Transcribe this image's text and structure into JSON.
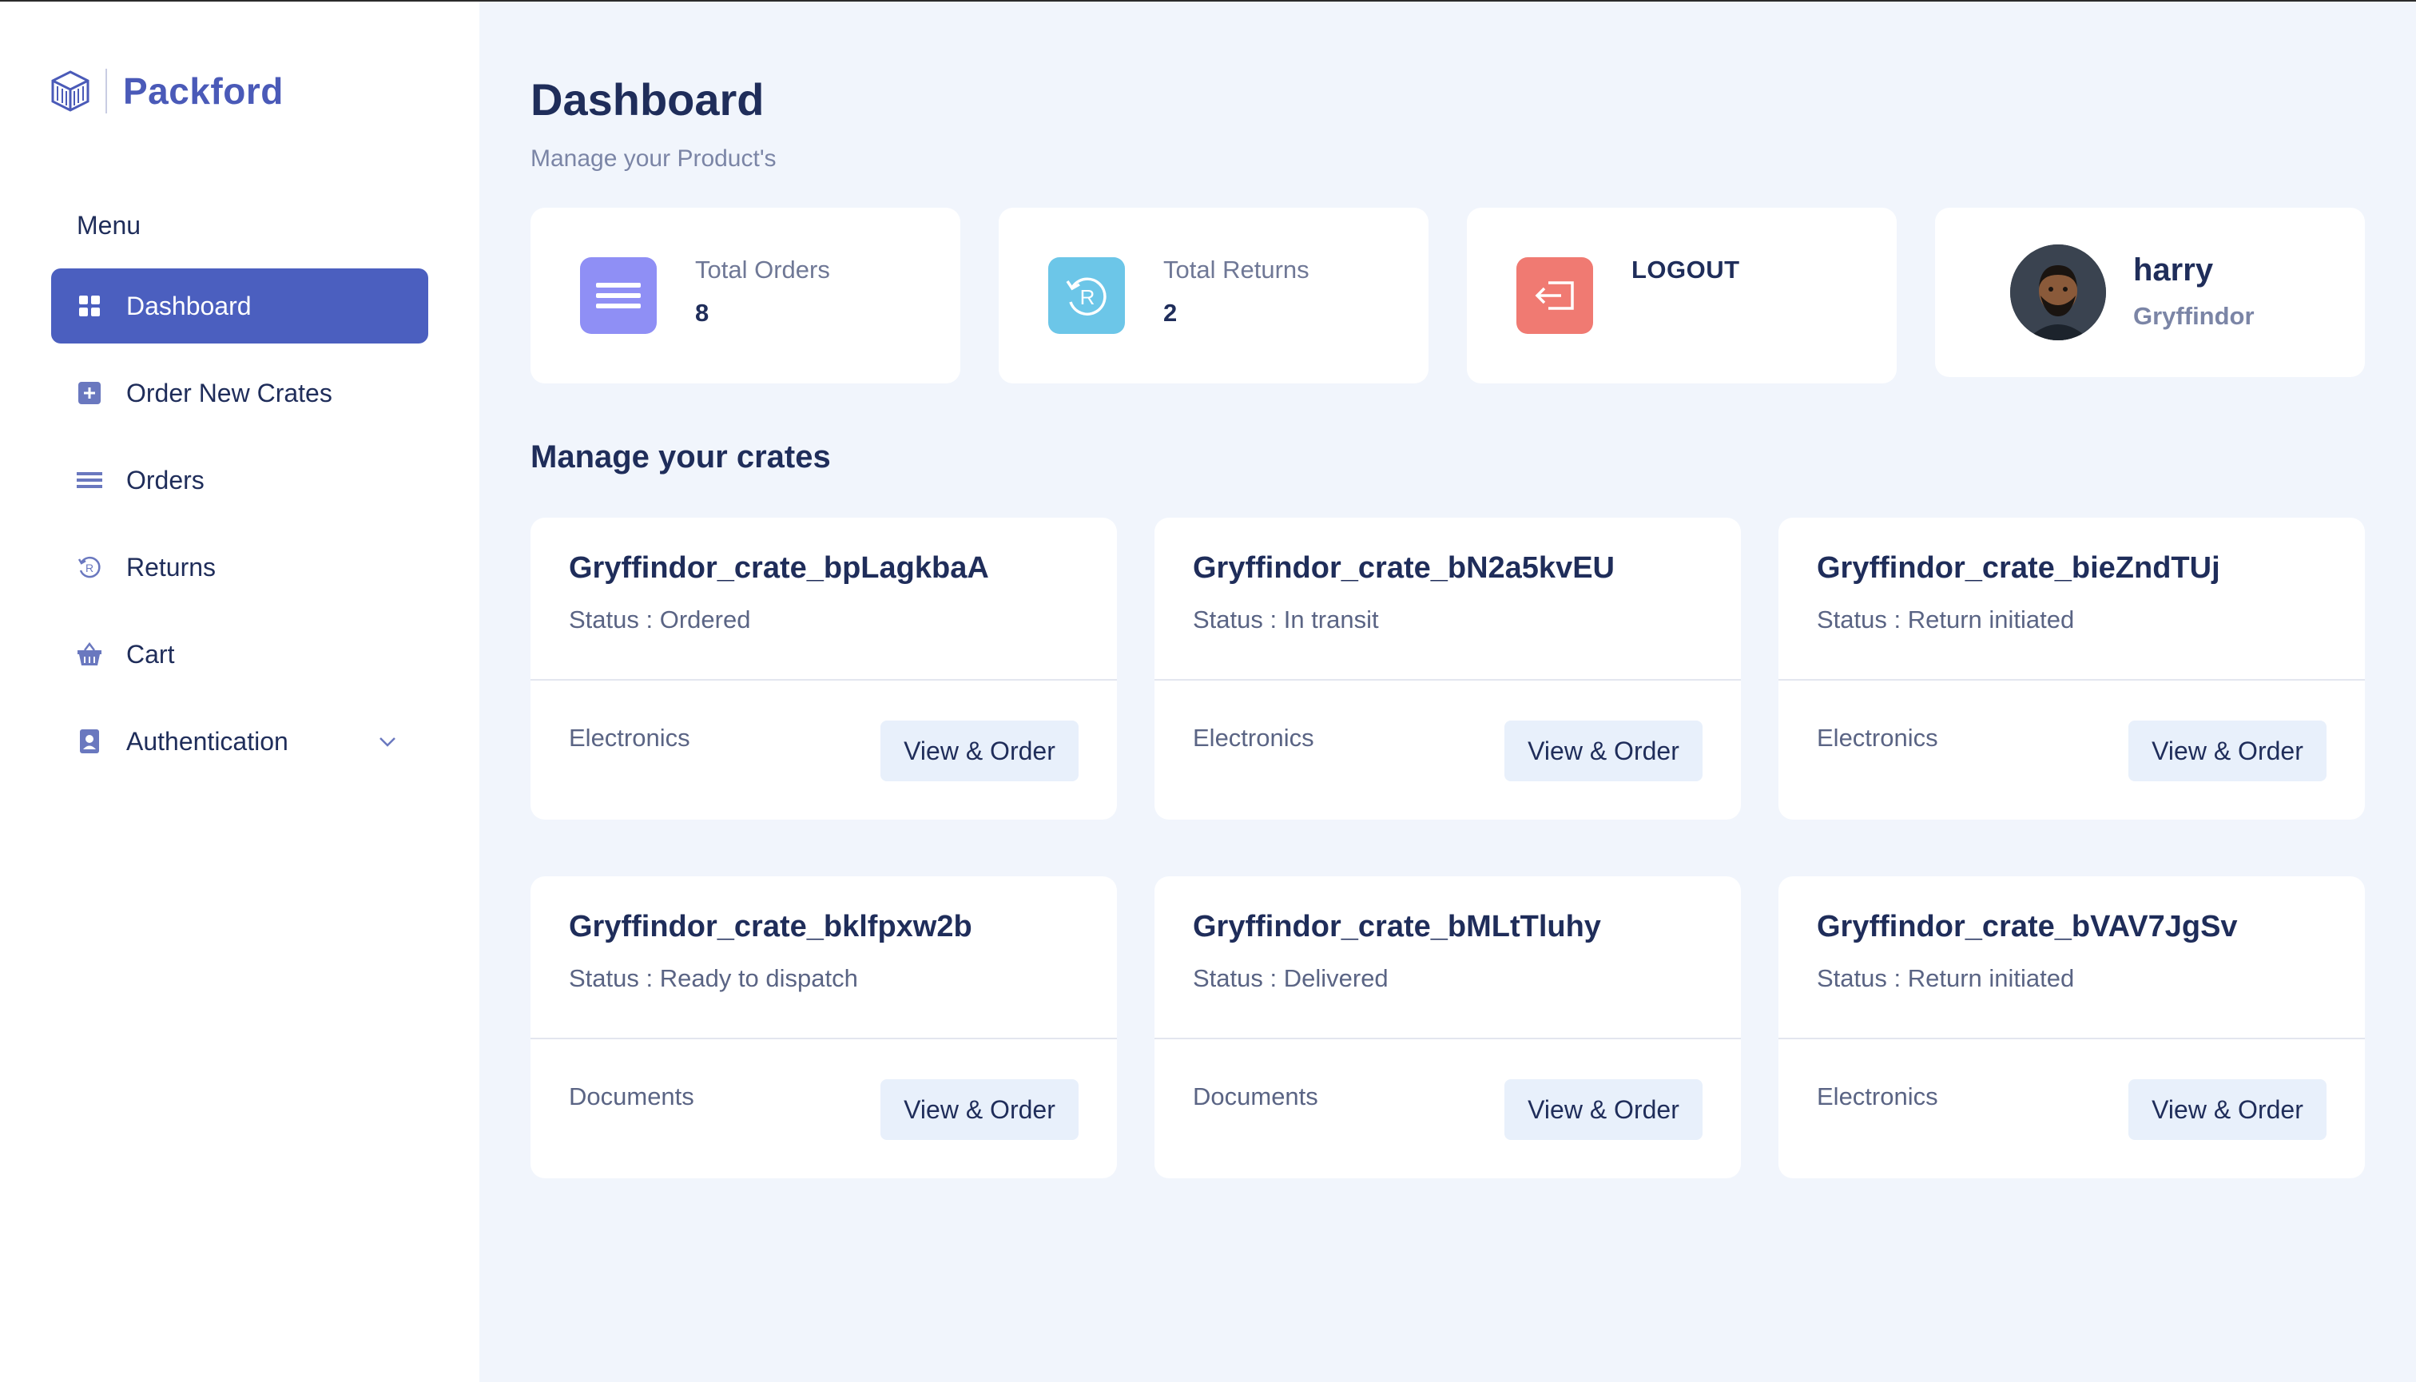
{
  "brand": {
    "name": "Packford"
  },
  "sidebar": {
    "menu_title": "Menu",
    "items": [
      {
        "label": "Dashboard",
        "icon": "grid-icon",
        "active": true
      },
      {
        "label": "Order New Crates",
        "icon": "plus-square-icon"
      },
      {
        "label": "Orders",
        "icon": "list-icon"
      },
      {
        "label": "Returns",
        "icon": "return-icon"
      },
      {
        "label": "Cart",
        "icon": "basket-icon"
      },
      {
        "label": "Authentication",
        "icon": "id-badge-icon",
        "has_dropdown": true
      }
    ]
  },
  "header": {
    "title": "Dashboard",
    "subtitle": "Manage your Product's"
  },
  "stats": {
    "total_orders": {
      "label": "Total Orders",
      "value": "8"
    },
    "total_returns": {
      "label": "Total Returns",
      "value": "2"
    },
    "logout": {
      "label": "LOGOUT"
    }
  },
  "profile": {
    "name": "harry",
    "house": "Gryffindor"
  },
  "crates_section": {
    "title": "Manage your crates"
  },
  "crates": [
    {
      "name": "Gryffindor_crate_bpLagkbaA",
      "status": "Status : Ordered",
      "category": "Electronics",
      "button": "View & Order"
    },
    {
      "name": "Gryffindor_crate_bN2a5kvEU",
      "status": "Status : In transit",
      "category": "Electronics",
      "button": "View & Order"
    },
    {
      "name": "Gryffindor_crate_bieZndTUj",
      "status": "Status : Return initiated",
      "category": "Electronics",
      "button": "View & Order"
    },
    {
      "name": "Gryffindor_crate_bklfpxw2b",
      "status": "Status : Ready to dispatch",
      "category": "Documents",
      "button": "View & Order"
    },
    {
      "name": "Gryffindor_crate_bMLtTluhy",
      "status": "Status : Delivered",
      "category": "Documents",
      "button": "View & Order"
    },
    {
      "name": "Gryffindor_crate_bVAV7JgSv",
      "status": "Status : Return initiated",
      "category": "Electronics",
      "button": "View & Order"
    }
  ],
  "colors": {
    "accent": "#4b5fbf",
    "orders_icon_bg": "#8f8ff5",
    "returns_icon_bg": "#6cc6e8",
    "logout_icon_bg": "#f07a72",
    "background": "#f1f5fc"
  }
}
